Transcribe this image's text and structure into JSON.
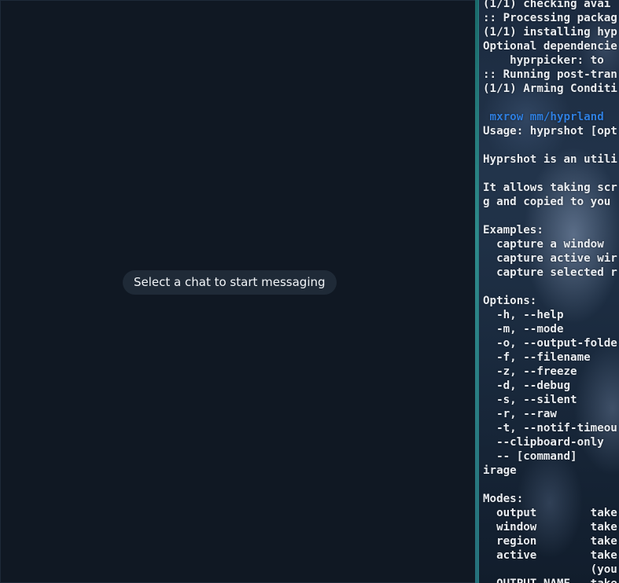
{
  "chat": {
    "empty_state": "Select a chat to start messaging"
  },
  "terminal": {
    "lines": [
      {
        "text": "(1/1) checking avai"
      },
      {
        "text": ":: Processing packag"
      },
      {
        "text": "(1/1) installing hyp"
      },
      {
        "text": "Optional dependencie"
      },
      {
        "text": "    hyprpicker: to "
      },
      {
        "text": ":: Running post-tran"
      },
      {
        "text": "(1/1) Arming Conditi"
      },
      {
        "text": ""
      },
      {
        "text": " mxrow mm/hyprland",
        "style": "prompt"
      },
      {
        "text": "Usage: hyprshot [opt"
      },
      {
        "text": ""
      },
      {
        "text": "Hyprshot is an utili"
      },
      {
        "text": ""
      },
      {
        "text": "It allows taking scr"
      },
      {
        "text": "g and copied to you"
      },
      {
        "text": ""
      },
      {
        "text": "Examples:"
      },
      {
        "text": "  capture a window"
      },
      {
        "text": "  capture active wir"
      },
      {
        "text": "  capture selected r"
      },
      {
        "text": ""
      },
      {
        "text": "Options:"
      },
      {
        "text": "  -h, --help"
      },
      {
        "text": "  -m, --mode"
      },
      {
        "text": "  -o, --output-folde"
      },
      {
        "text": "  -f, --filename"
      },
      {
        "text": "  -z, --freeze"
      },
      {
        "text": "  -d, --debug"
      },
      {
        "text": "  -s, --silent"
      },
      {
        "text": "  -r, --raw"
      },
      {
        "text": "  -t, --notif-timeou"
      },
      {
        "text": "  --clipboard-only"
      },
      {
        "text": "  -- [command]"
      },
      {
        "text": "irage"
      },
      {
        "text": ""
      },
      {
        "text": "Modes:"
      },
      {
        "text": "  output        take"
      },
      {
        "text": "  window        take"
      },
      {
        "text": "  region        take"
      },
      {
        "text": "  active        take"
      },
      {
        "text": "                (you"
      },
      {
        "text": "  OUTPUT_NAME   take"
      }
    ]
  },
  "colors": {
    "chat_bg": "#101823",
    "pill_bg": "#1f2a37",
    "terminal_text": "#e9edf2",
    "prompt_blue": "#2f7fe0",
    "active_border": "#2d8a8a"
  }
}
